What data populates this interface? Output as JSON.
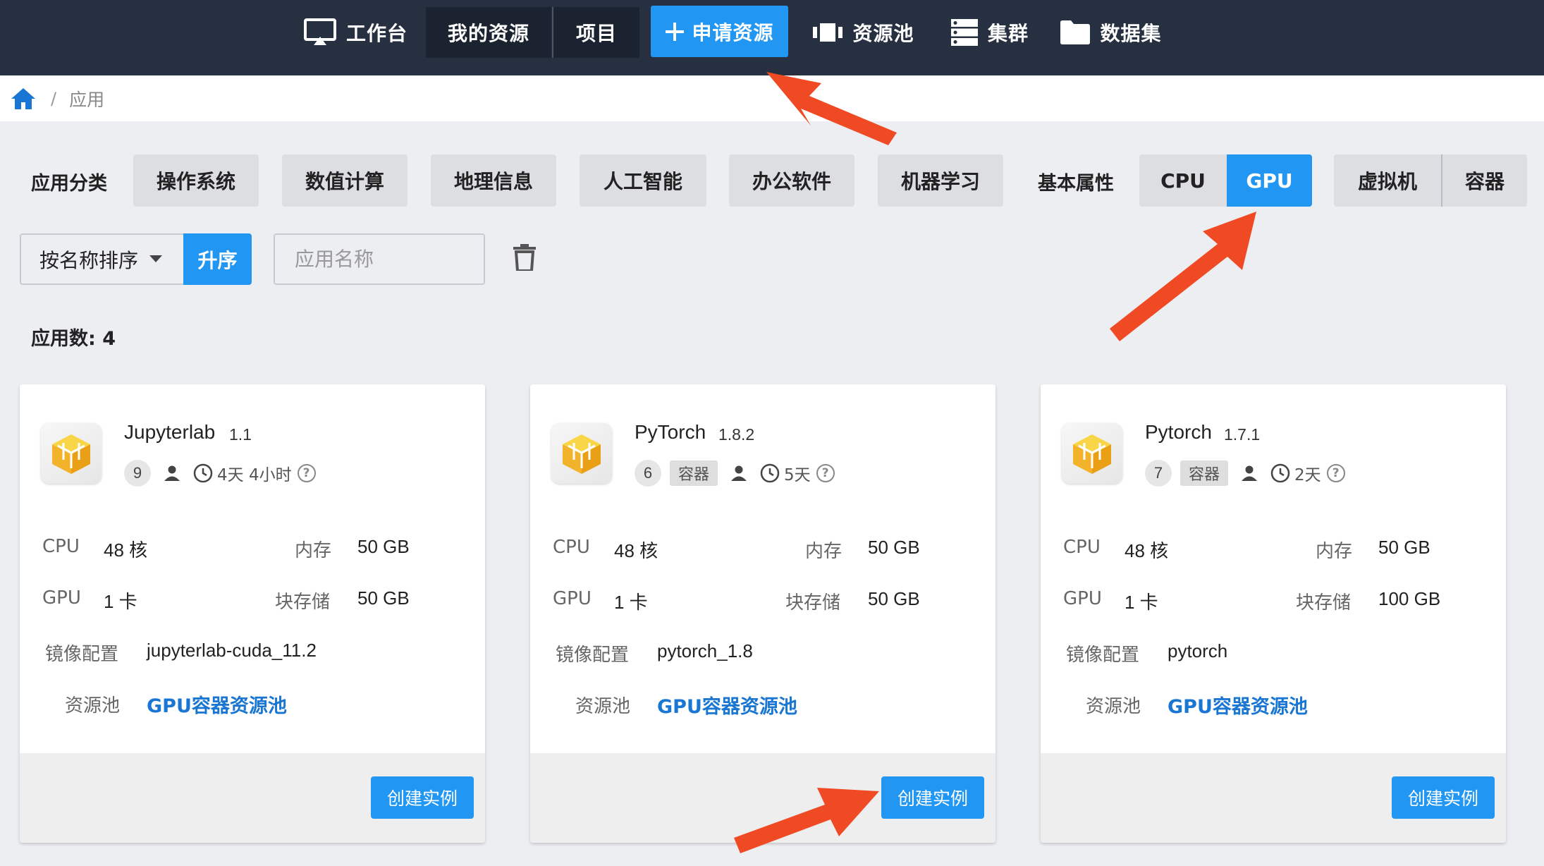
{
  "nav": {
    "workbench": "工作台",
    "my_resources": "我的资源",
    "projects": "项目",
    "apply_resource": "申请资源",
    "resource_pool": "资源池",
    "cluster": "集群",
    "dataset": "数据集"
  },
  "breadcrumb": {
    "current": "应用"
  },
  "filters": {
    "category_label": "应用分类",
    "categories": [
      "操作系统",
      "数值计算",
      "地理信息",
      "人工智能",
      "办公软件",
      "机器学习"
    ],
    "attribute_label": "基本属性",
    "compute": [
      "CPU",
      "GPU"
    ],
    "compute_selected": "GPU",
    "env": [
      "虚拟机",
      "容器"
    ]
  },
  "sort": {
    "field": "按名称排序",
    "order": "升序",
    "search_placeholder": "应用名称"
  },
  "count_text": "应用数: 4",
  "labels": {
    "cpu": "CPU",
    "memory": "内存",
    "gpu": "GPU",
    "block_storage": "块存储",
    "image": "镜像配置",
    "pool": "资源池",
    "create": "创建实例"
  },
  "apps": [
    {
      "name": "Jupyterlab",
      "version": "1.1",
      "count": "9",
      "tag": "",
      "duration": "4天 4小时",
      "cpu": "48 核",
      "memory": "50 GB",
      "gpu": "1 卡",
      "storage": "50 GB",
      "image": "jupyterlab-cuda_11.2",
      "pool": "GPU容器资源池"
    },
    {
      "name": "PyTorch",
      "version": "1.8.2",
      "count": "6",
      "tag": "容器",
      "duration": "5天",
      "cpu": "48 核",
      "memory": "50 GB",
      "gpu": "1 卡",
      "storage": "50 GB",
      "image": "pytorch_1.8",
      "pool": "GPU容器资源池"
    },
    {
      "name": "Pytorch",
      "version": "1.7.1",
      "count": "7",
      "tag": "容器",
      "duration": "2天",
      "cpu": "48 核",
      "memory": "50 GB",
      "gpu": "1 卡",
      "storage": "100 GB",
      "image": "pytorch",
      "pool": "GPU容器资源池"
    }
  ],
  "colors": {
    "nav_bg": "#263040",
    "primary": "#2196f3",
    "link": "#1976d2",
    "annotation_arrow": "#f04a24"
  }
}
